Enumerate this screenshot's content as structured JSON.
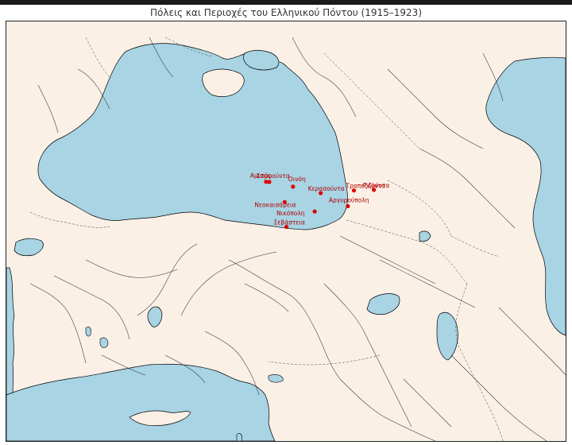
{
  "title": "Πόλεις και Περιοχές του Ελληνικού Πόντου (1915–1923)",
  "colors": {
    "land": "#faf0e6",
    "water": "#a8d4e4",
    "coast": "#000000",
    "border": "#444444",
    "river": "#333333",
    "marker": "#e00000",
    "label": "#b00000"
  },
  "cities": [
    {
      "name": "Σαμψούντα",
      "lon": 36.33,
      "lat": 41.29
    },
    {
      "name": "Αμισός",
      "lon": 36.2,
      "lat": 41.3
    },
    {
      "name": "Οινόη",
      "lon": 37.28,
      "lat": 41.13
    },
    {
      "name": "Κερασούντα",
      "lon": 38.39,
      "lat": 40.91
    },
    {
      "name": "Τραπεζούντα",
      "lon": 39.72,
      "lat": 41.0
    },
    {
      "name": "Ριζούντα",
      "lon": 40.52,
      "lat": 41.02
    },
    {
      "name": "Νικόπολη",
      "lon": 38.15,
      "lat": 40.28
    },
    {
      "name": "Αργυρούπολη",
      "lon": 39.48,
      "lat": 40.46
    },
    {
      "name": "Νεοκαισάρεια",
      "lon": 36.95,
      "lat": 40.6
    },
    {
      "name": "Σεβάστεια",
      "lon": 37.02,
      "lat": 39.75
    }
  ]
}
